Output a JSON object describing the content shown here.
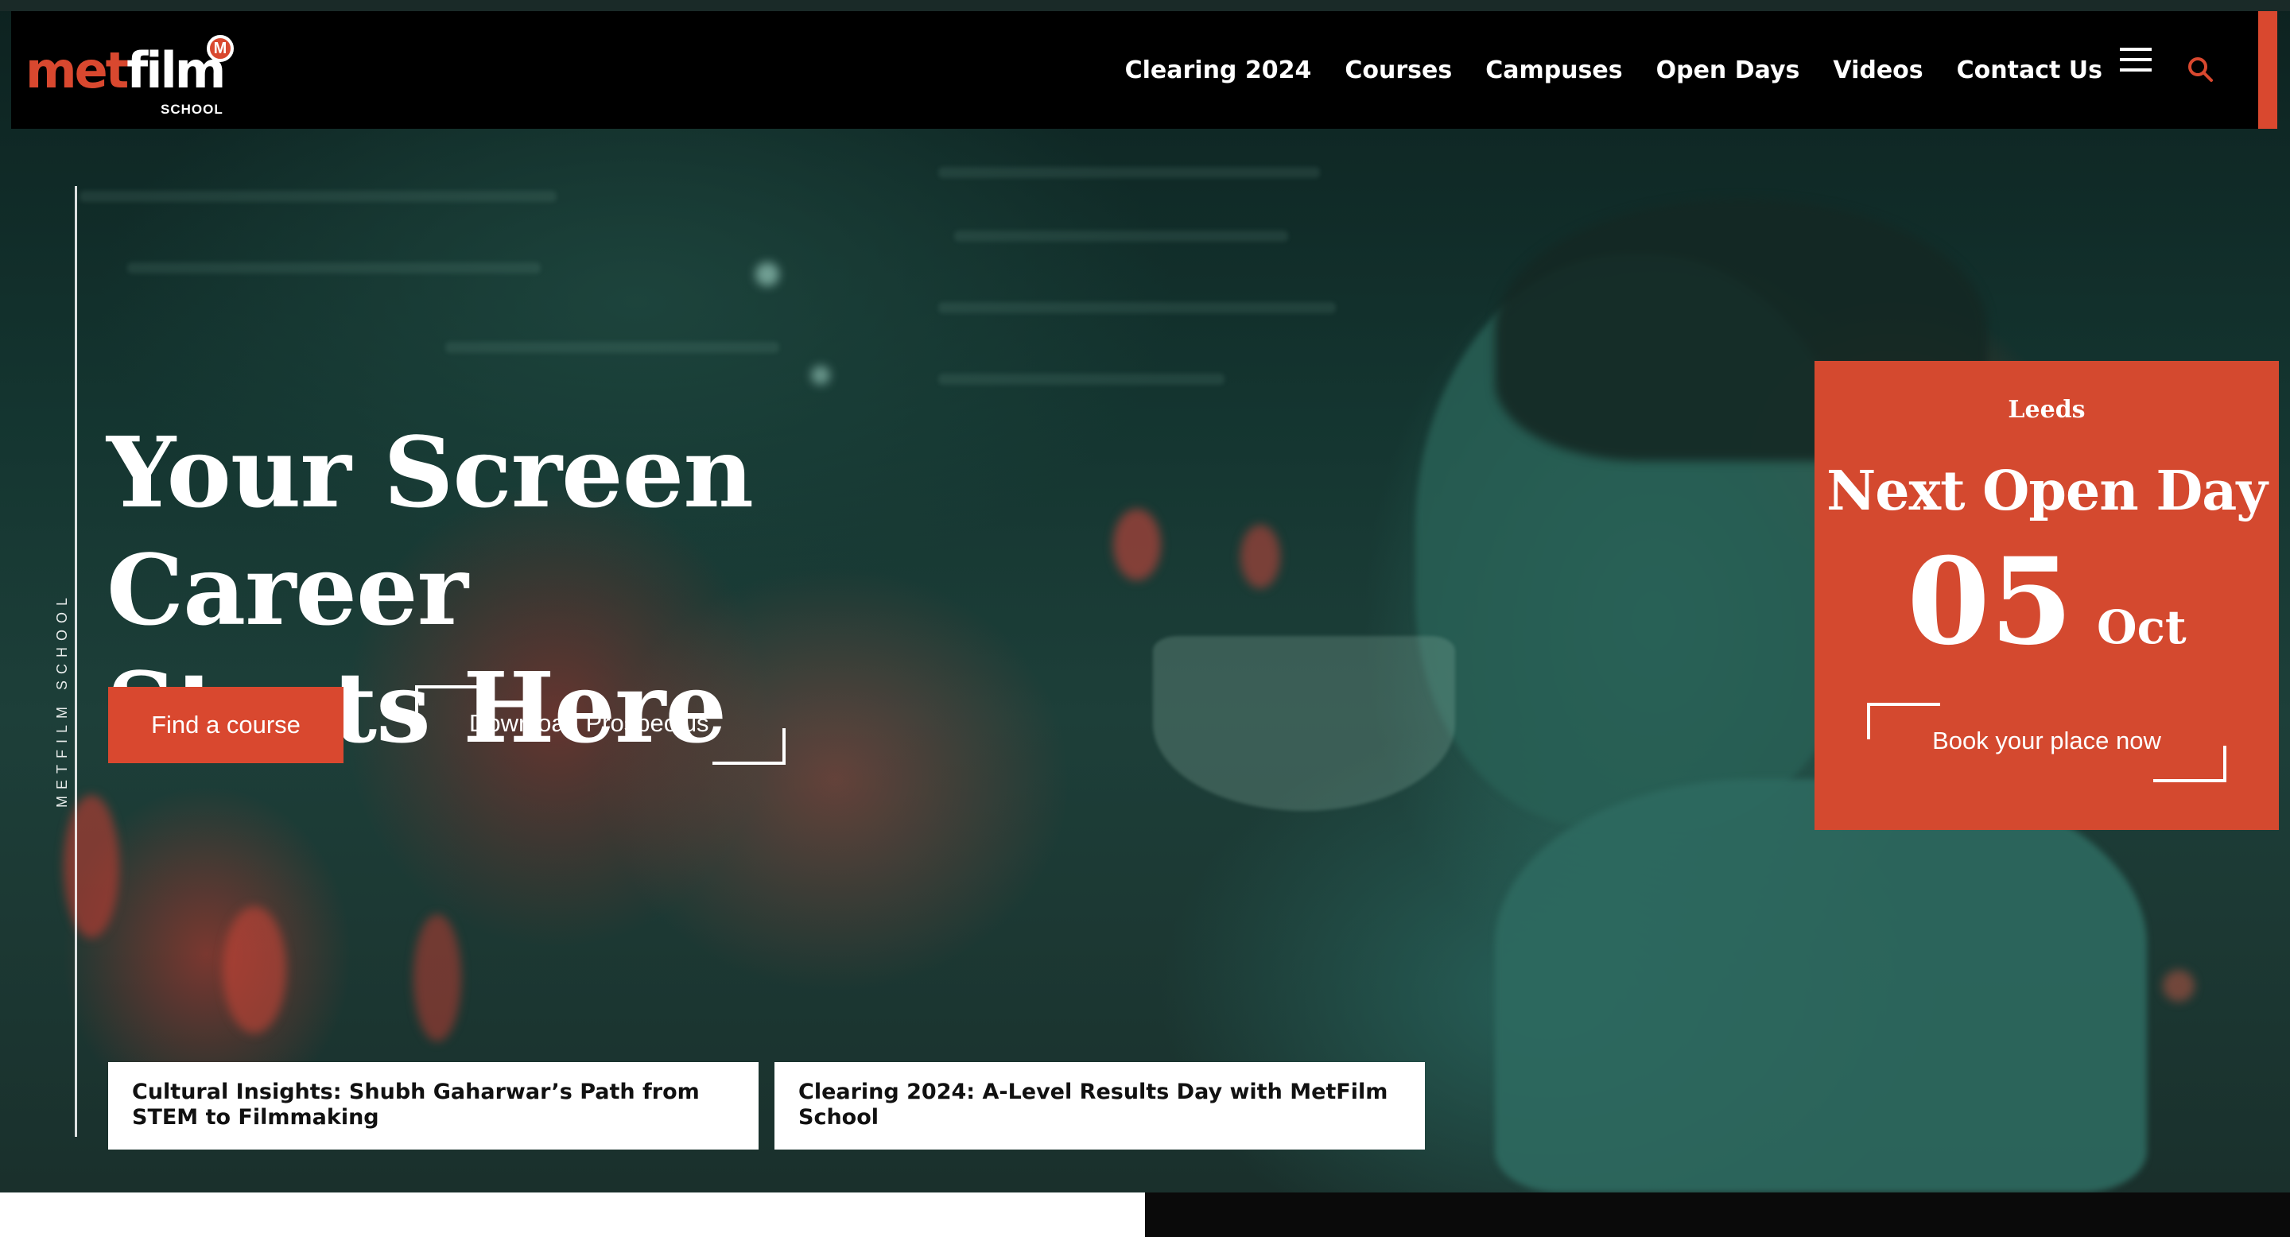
{
  "brand": {
    "logo_primary": "met",
    "logo_secondary": "film",
    "logo_badge": "M",
    "logo_sub": "SCHOOL",
    "accent_color": "#d9482f"
  },
  "nav": {
    "items": [
      "Clearing 2024",
      "Courses",
      "Campuses",
      "Open Days",
      "Videos",
      "Contact Us"
    ],
    "menu_icon": "hamburger-icon",
    "search_icon": "search-icon"
  },
  "side_label": "METFILM SCHOOL",
  "hero": {
    "title_line1": "Your Screen Career",
    "title_line2": "Starts Here",
    "cta_primary": "Find a course",
    "cta_secondary": "Download Prospectus"
  },
  "open_day": {
    "campus": "Leeds",
    "title": "Next Open Day",
    "day": "05",
    "month": "Oct",
    "cta": "Book your place now"
  },
  "news": [
    {
      "title": "Cultural Insights: Shubh Gaharwar’s Path from STEM to Filmmaking"
    },
    {
      "title": "Clearing 2024: A-Level Results Day with MetFilm School"
    }
  ]
}
